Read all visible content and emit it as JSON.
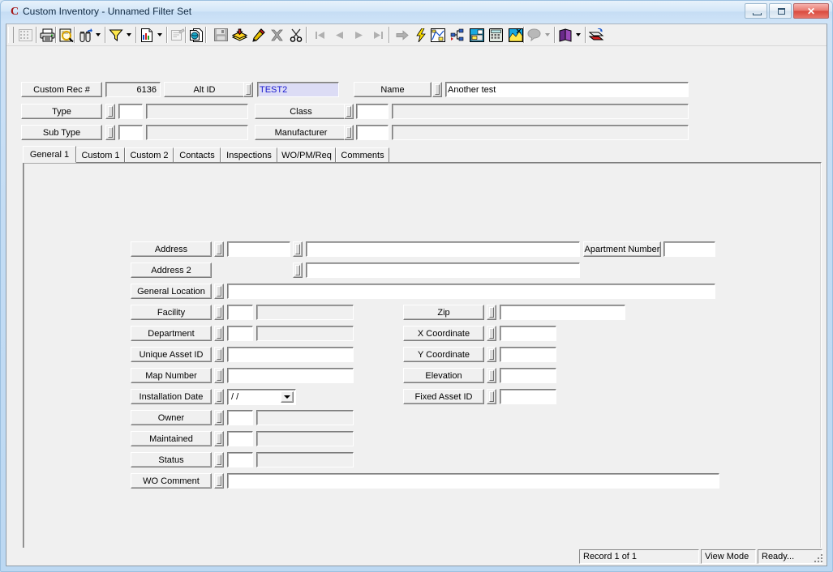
{
  "window": {
    "title": "Custom Inventory - Unnamed Filter Set",
    "app_icon": "C",
    "buttons": {
      "minimize": "minimize-icon",
      "restore": "restore-icon",
      "close": "✕"
    }
  },
  "toolbar": {
    "items": [
      {
        "name": "grid-view-icon",
        "kind": "button",
        "enabled": false
      },
      {
        "name": "print-icon",
        "kind": "button",
        "enabled": true
      },
      {
        "name": "print-preview-icon",
        "kind": "button",
        "enabled": true
      },
      {
        "name": "find-icon",
        "kind": "button",
        "enabled": true
      },
      {
        "name": "find-dropdown-arrow-icon",
        "kind": "dropdown",
        "enabled": true
      },
      {
        "name": "filter-funnel-icon",
        "kind": "button",
        "enabled": true
      },
      {
        "name": "filter-dropdown-arrow-icon",
        "kind": "dropdown",
        "enabled": true
      },
      {
        "name": "report-icon",
        "kind": "button",
        "enabled": true
      },
      {
        "name": "report-dropdown-arrow-icon",
        "kind": "dropdown",
        "enabled": true
      },
      {
        "name": "form-design-icon",
        "kind": "button",
        "enabled": false
      },
      {
        "name": "copy-record-icon",
        "kind": "button",
        "enabled": true
      },
      {
        "name": "save-icon",
        "kind": "button",
        "enabled": false
      },
      {
        "name": "add-record-icon",
        "kind": "button",
        "enabled": true
      },
      {
        "name": "edit-record-icon",
        "kind": "button",
        "enabled": true
      },
      {
        "name": "delete-record-icon",
        "kind": "button",
        "enabled": true
      },
      {
        "name": "cut-scissors-icon",
        "kind": "button",
        "enabled": true
      },
      {
        "name": "first-record-icon",
        "kind": "button",
        "enabled": false
      },
      {
        "name": "previous-record-icon",
        "kind": "button",
        "enabled": false
      },
      {
        "name": "next-record-icon",
        "kind": "button",
        "enabled": false
      },
      {
        "name": "last-record-icon",
        "kind": "button",
        "enabled": false
      },
      {
        "name": "goto-record-icon",
        "kind": "button",
        "enabled": false
      },
      {
        "name": "quick-action-lightning-icon",
        "kind": "button",
        "enabled": true
      },
      {
        "name": "map-view-icon",
        "kind": "button",
        "enabled": true
      },
      {
        "name": "tree-view-icon",
        "kind": "button",
        "enabled": true
      },
      {
        "name": "work-order-icon",
        "kind": "button",
        "enabled": true
      },
      {
        "name": "calculator-icon",
        "kind": "button",
        "enabled": true
      },
      {
        "name": "gis-link-icon",
        "kind": "button",
        "enabled": true
      },
      {
        "name": "help-balloon-icon",
        "kind": "button",
        "enabled": false
      },
      {
        "name": "help-dropdown-arrow-icon",
        "kind": "dropdown",
        "enabled": false
      },
      {
        "name": "books-module-icon",
        "kind": "button",
        "enabled": true
      },
      {
        "name": "books-dropdown-arrow-icon",
        "kind": "dropdown",
        "enabled": true
      },
      {
        "name": "exit-icon",
        "kind": "button",
        "enabled": true
      }
    ]
  },
  "header": {
    "custom_rec_label": "Custom Rec #",
    "custom_rec_value": "6136",
    "alt_id_label": "Alt ID",
    "alt_id_value": "TEST2",
    "name_label": "Name",
    "name_value": "Another test",
    "type_label": "Type",
    "type_code": "",
    "type_desc": "",
    "subtype_label": "Sub Type",
    "subtype_code": "",
    "subtype_desc": "",
    "class_label": "Class",
    "class_code": "",
    "class_desc": "",
    "manufacturer_label": "Manufacturer",
    "manufacturer_code": "",
    "manufacturer_desc": ""
  },
  "tabs": [
    {
      "label": "General 1",
      "active": true
    },
    {
      "label": "Custom 1",
      "active": false
    },
    {
      "label": "Custom 2",
      "active": false
    },
    {
      "label": "Contacts",
      "active": false
    },
    {
      "label": "Inspections",
      "active": false
    },
    {
      "label": "WO/PM/Req",
      "active": false
    },
    {
      "label": "Comments",
      "active": false
    }
  ],
  "general1": {
    "address_label": "Address",
    "address_number": "",
    "address_street": "",
    "apartment_label": "Apartment Number",
    "apartment_value": "",
    "address2_label": "Address 2",
    "address2_value": "",
    "general_location_label": "General Location",
    "general_location_value": "",
    "facility_label": "Facility",
    "facility_code": "",
    "facility_desc": "",
    "department_label": "Department",
    "department_code": "",
    "department_desc": "",
    "unique_asset_label": "Unique Asset ID",
    "unique_asset_value": "",
    "map_number_label": "Map Number",
    "map_number_value": "",
    "installation_date_label": "Installation Date",
    "installation_date_value": "/ /",
    "owner_label": "Owner",
    "owner_code": "",
    "owner_desc": "",
    "maintained_label": "Maintained",
    "maintained_code": "",
    "maintained_desc": "",
    "status_label": "Status",
    "status_code": "",
    "status_desc": "",
    "wo_comment_label": "WO Comment",
    "wo_comment_value": "",
    "zip_label": "Zip",
    "zip_value": "",
    "x_coordinate_label": "X Coordinate",
    "x_coordinate_value": "",
    "y_coordinate_label": "Y Coordinate",
    "y_coordinate_value": "",
    "elevation_label": "Elevation",
    "elevation_value": "",
    "fixed_asset_label": "Fixed Asset ID",
    "fixed_asset_value": ""
  },
  "statusbar": {
    "record_position": "Record 1 of 1",
    "mode": "View Mode",
    "state": "Ready..."
  },
  "colors": {
    "window_frame": "#c3dcf4",
    "face": "#f0f0f0",
    "selected_field_bg": "#dcdcf5",
    "selected_field_text": "#1a1ad0",
    "close_button": "#d9483c"
  }
}
